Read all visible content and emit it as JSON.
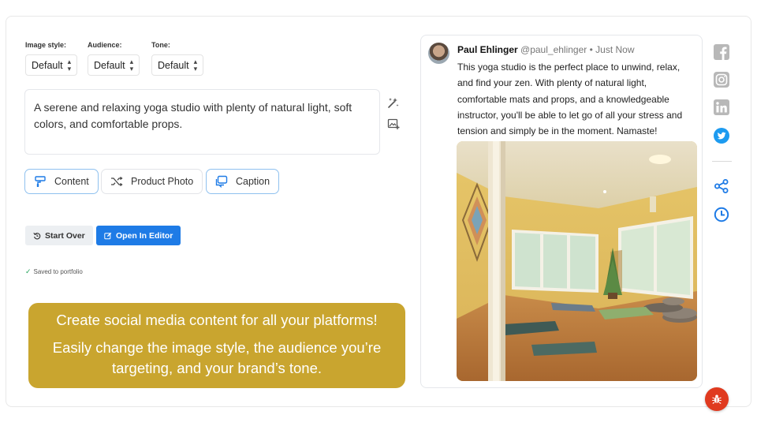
{
  "selectors": [
    {
      "label": "Image style:",
      "value": "Default"
    },
    {
      "label": "Audience:",
      "value": "Default"
    },
    {
      "label": "Tone:",
      "value": "Default"
    }
  ],
  "prompt": {
    "text": "A serene and relaxing yoga studio with plenty of natural light, soft colors, and comfortable props."
  },
  "tabs": [
    {
      "label": "Content",
      "icon": "brush-icon",
      "active": true
    },
    {
      "label": "Product Photo",
      "icon": "shuffle-icon",
      "active": false
    },
    {
      "label": "Caption",
      "icon": "message-square-icon",
      "active": true
    }
  ],
  "actions": {
    "start_over": "Start Over",
    "open_in_editor": "Open In Editor"
  },
  "status": {
    "saved": "Saved to portfolio"
  },
  "promo": {
    "line1": "Create social media content for all your platforms!",
    "line2": "Easily change the image style, the audience you’re targeting, and your brand’s tone."
  },
  "post": {
    "name": "Paul Ehlinger",
    "handle": "@paul_ehlinger",
    "separator": "•",
    "time": "Just Now",
    "body": "This yoga studio is the perfect place to unwind, relax, and find your zen. With plenty of natural light, comfortable mats and props, and a knowledgeable instructor, you'll be able to let go of all your stress and tension and simply be in the moment. Namaste!"
  },
  "social_icons": [
    "facebook-icon",
    "instagram-icon",
    "linkedin-icon",
    "twitter-icon",
    "share-icon",
    "clock-icon"
  ],
  "colors": {
    "accent_blue": "#1e7be6",
    "promo_gold": "#c9a52f",
    "twitter_blue": "#1d9bf0",
    "bug_red": "#e03a1f"
  }
}
